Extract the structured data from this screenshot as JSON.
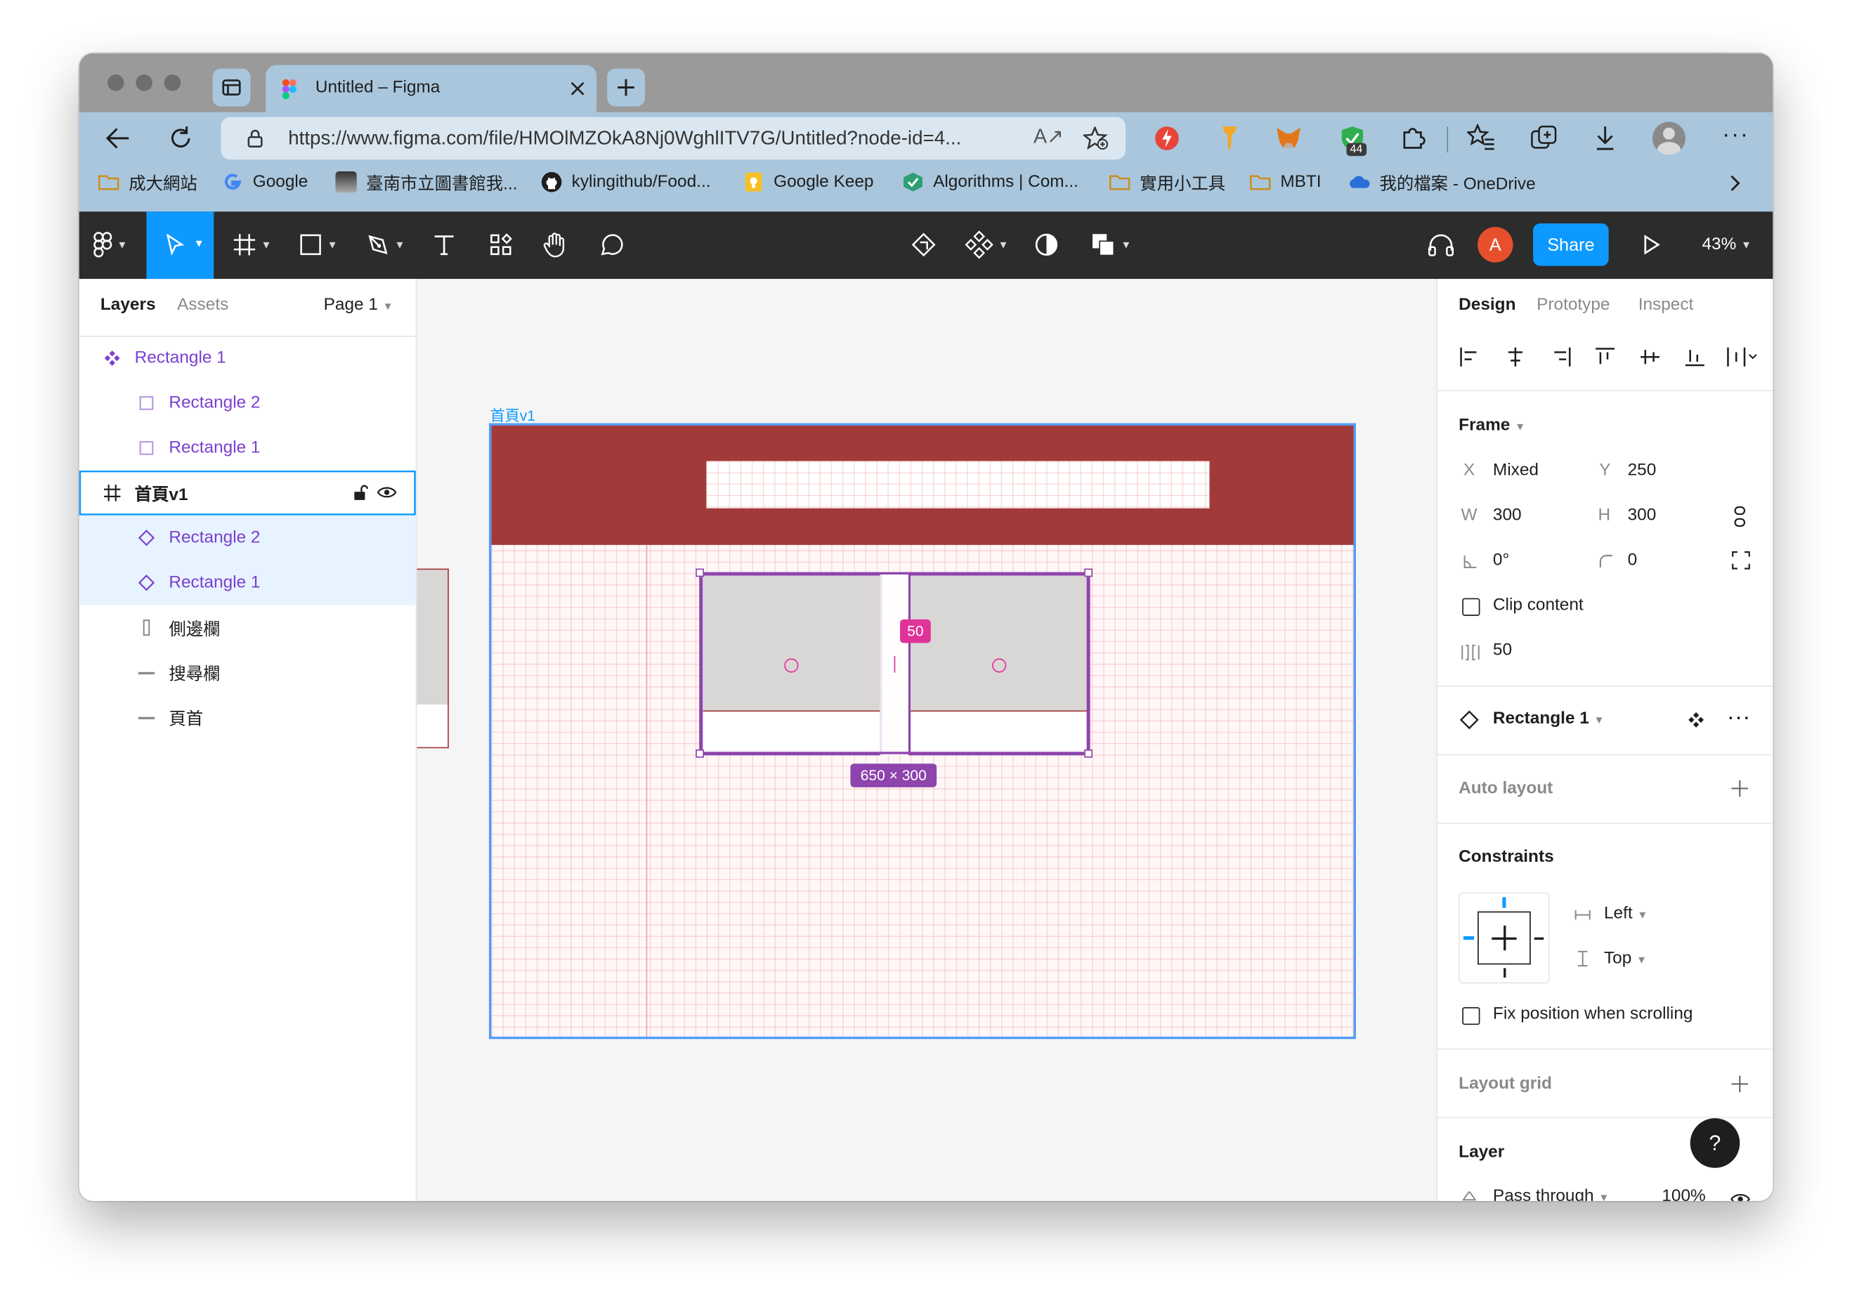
{
  "browser": {
    "tab_title": "Untitled – Figma",
    "url": "https://www.figma.com/file/HMOlMZOkA8Nj0WghlITV7G/Untitled?node-id=4...",
    "extension_badge": "44",
    "bookmarks": [
      {
        "label": "成大網站",
        "icon": "folder-icon",
        "color": "#e8b33a"
      },
      {
        "label": "Google",
        "icon": "google-icon",
        "color": "#4285f4"
      },
      {
        "label": "臺南市立圖書館我...",
        "icon": "library-icon",
        "color": "#555555"
      },
      {
        "label": "kylingithub/Food...",
        "icon": "github-icon",
        "color": "#1e1e1e"
      },
      {
        "label": "Google Keep",
        "icon": "keep-icon",
        "color": "#f6bf26"
      },
      {
        "label": "Algorithms | Com...",
        "icon": "algorithms-icon",
        "color": "#2e9e74"
      },
      {
        "label": "實用小工具",
        "icon": "folder-icon",
        "color": "#e8b33a"
      },
      {
        "label": "MBTI",
        "icon": "folder-icon",
        "color": "#e8b33a"
      },
      {
        "label": "我的檔案 - OneDrive",
        "icon": "onedrive-icon",
        "color": "#2a6ed8"
      }
    ]
  },
  "toolbar": {
    "avatar_letter": "A",
    "share_label": "Share",
    "zoom": "43%",
    "accent": "#0d99ff"
  },
  "layers_panel": {
    "tabs": [
      "Layers",
      "Assets"
    ],
    "page": "Page 1",
    "items": [
      {
        "label": "Rectangle 1",
        "kind": "component"
      },
      {
        "label": "Rectangle 2",
        "kind": "rectangle"
      },
      {
        "label": "Rectangle 1",
        "kind": "rectangle"
      },
      {
        "label": "首頁v1",
        "kind": "frame"
      },
      {
        "label": "Rectangle 2",
        "kind": "instance"
      },
      {
        "label": "Rectangle 1",
        "kind": "instance"
      },
      {
        "label": "側邊欄",
        "kind": "rectangle"
      },
      {
        "label": "搜尋欄",
        "kind": "line"
      },
      {
        "label": "頁首",
        "kind": "line"
      }
    ]
  },
  "canvas": {
    "frame_label": "首頁v1",
    "spacing_badge": "50",
    "size_badge": "650 × 300",
    "header_color": "#a23a3a",
    "selection_color": "#8e44ad"
  },
  "design_panel": {
    "tabs": [
      "Design",
      "Prototype",
      "Inspect"
    ],
    "frame_title": "Frame",
    "x_label": "X",
    "x_value": "Mixed",
    "y_label": "Y",
    "y_value": "250",
    "w_label": "W",
    "w_value": "300",
    "h_label": "H",
    "h_value": "300",
    "rotation": "0°",
    "radius": "0",
    "clip_content": "Clip content",
    "spacing": "50",
    "component_name": "Rectangle 1",
    "auto_layout": "Auto layout",
    "constraints_title": "Constraints",
    "constraint_h": "Left",
    "constraint_v": "Top",
    "fix_position": "Fix position when scrolling",
    "layout_grid": "Layout grid",
    "layer_title": "Layer",
    "blend_mode": "Pass through",
    "opacity": "100%",
    "help": "?"
  }
}
